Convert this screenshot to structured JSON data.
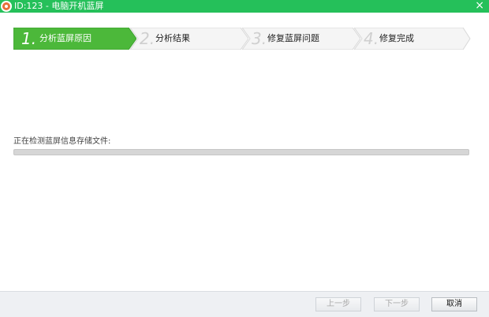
{
  "window": {
    "title": "ID:123 - 电脑开机蓝屏",
    "close_glyph": "×"
  },
  "steps": [
    {
      "num": "1.",
      "label": "分析蓝屏原因",
      "active": true
    },
    {
      "num": "2.",
      "label": "分析结果",
      "active": false
    },
    {
      "num": "3.",
      "label": "修复蓝屏问题",
      "active": false
    },
    {
      "num": "4.",
      "label": "修复完成",
      "active": false
    }
  ],
  "status": {
    "text": "正在检测蓝屏信息存储文件:",
    "progress": 0
  },
  "footer": {
    "prev_label": "上一步",
    "next_label": "下一步",
    "cancel_label": "取消"
  },
  "colors": {
    "accent": "#25c05a",
    "step_active": "#4cb83a",
    "step_inactive": "#f5f5f5"
  }
}
